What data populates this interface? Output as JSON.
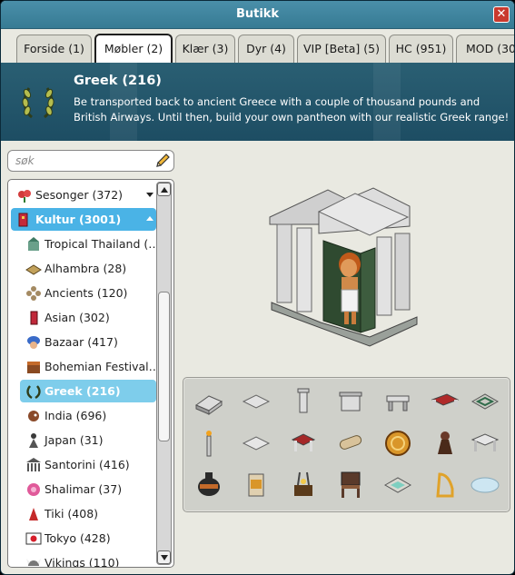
{
  "window": {
    "title": "Butikk",
    "close_label": "✕"
  },
  "tabs": [
    {
      "label": "Forside (1)",
      "active": false
    },
    {
      "label": "Møbler (2)",
      "active": true
    },
    {
      "label": "Klær (3)",
      "active": false
    },
    {
      "label": "Dyr (4)",
      "active": false
    },
    {
      "label": "VIP [Beta] (5)",
      "active": false
    },
    {
      "label": "HC (951)",
      "active": false
    },
    {
      "label": "MOD (30",
      "active": false
    }
  ],
  "banner": {
    "title": "Greek (216)",
    "description": "Be transported back to ancient Greece with a couple of thousand pounds and British Airways. Until then, build your own pantheon with our realistic Greek range!",
    "icon": "laurel-wreath-icon",
    "background_text": "GREEK"
  },
  "search": {
    "placeholder": "søk",
    "value": "",
    "icon": "pencil-icon"
  },
  "categories": [
    {
      "label": "Sesonger (372)",
      "icon": "flower-icon",
      "level": 0,
      "expanded": false,
      "selected": false
    },
    {
      "label": "Kultur (3001)",
      "icon": "book-icon",
      "level": 0,
      "expanded": true,
      "selected": true
    },
    {
      "label": "Tropical Thailand (…",
      "icon": "tropical-icon",
      "level": 1,
      "selected": false
    },
    {
      "label": "Alhambra (28)",
      "icon": "rug-icon",
      "level": 1,
      "selected": false
    },
    {
      "label": "Ancients (120)",
      "icon": "ancients-icon",
      "level": 1,
      "selected": false
    },
    {
      "label": "Asian (302)",
      "icon": "lantern-icon",
      "level": 1,
      "selected": false
    },
    {
      "label": "Bazaar (417)",
      "icon": "turban-icon",
      "level": 1,
      "selected": false
    },
    {
      "label": "Bohemian Festival…",
      "icon": "chest-icon",
      "level": 1,
      "selected": false
    },
    {
      "label": "Greek (216)",
      "icon": "laurel-wreath-icon",
      "level": 1,
      "selected": true
    },
    {
      "label": "India (696)",
      "icon": "elephant-icon",
      "level": 1,
      "selected": false
    },
    {
      "label": "Japan (31)",
      "icon": "figure-icon",
      "level": 1,
      "selected": false
    },
    {
      "label": "Santorini (416)",
      "icon": "temple-icon",
      "level": 1,
      "selected": false
    },
    {
      "label": "Shalimar (37)",
      "icon": "cushion-icon",
      "level": 1,
      "selected": false
    },
    {
      "label": "Tiki (408)",
      "icon": "tiki-icon",
      "level": 1,
      "selected": false
    },
    {
      "label": "Tokyo (428)",
      "icon": "japan-flag-icon",
      "level": 1,
      "selected": false
    },
    {
      "label": "Vikings (110)",
      "icon": "viking-helmet-icon",
      "level": 1,
      "selected": false
    }
  ],
  "preview": {
    "item": "greek-temple-gate",
    "description": "avatar standing in greek temple gate"
  },
  "products": [
    {
      "name": "marble-slab-icon"
    },
    {
      "name": "floor-tile-icon"
    },
    {
      "name": "column-icon"
    },
    {
      "name": "column-section-icon"
    },
    {
      "name": "marble-bench-icon"
    },
    {
      "name": "red-bed-icon"
    },
    {
      "name": "floor-mosaic-icon"
    },
    {
      "name": "torch-stand-icon"
    },
    {
      "name": "marble-tile-icon"
    },
    {
      "name": "red-table-icon"
    },
    {
      "name": "scroll-icon"
    },
    {
      "name": "gold-coin-icon"
    },
    {
      "name": "bust-icon"
    },
    {
      "name": "marble-table-icon"
    },
    {
      "name": "amphora-icon"
    },
    {
      "name": "pedestal-icon"
    },
    {
      "name": "lyre-basket-icon"
    },
    {
      "name": "wooden-chair-icon"
    },
    {
      "name": "fountain-icon"
    },
    {
      "name": "golden-harp-icon"
    },
    {
      "name": "cloud-rug-icon"
    }
  ],
  "colors": {
    "titlebar": "#3f86a0",
    "banner": "#24566b",
    "selected": "#7ecdeb",
    "selected_parent": "#4ab3e6",
    "close": "#c93a2e"
  }
}
